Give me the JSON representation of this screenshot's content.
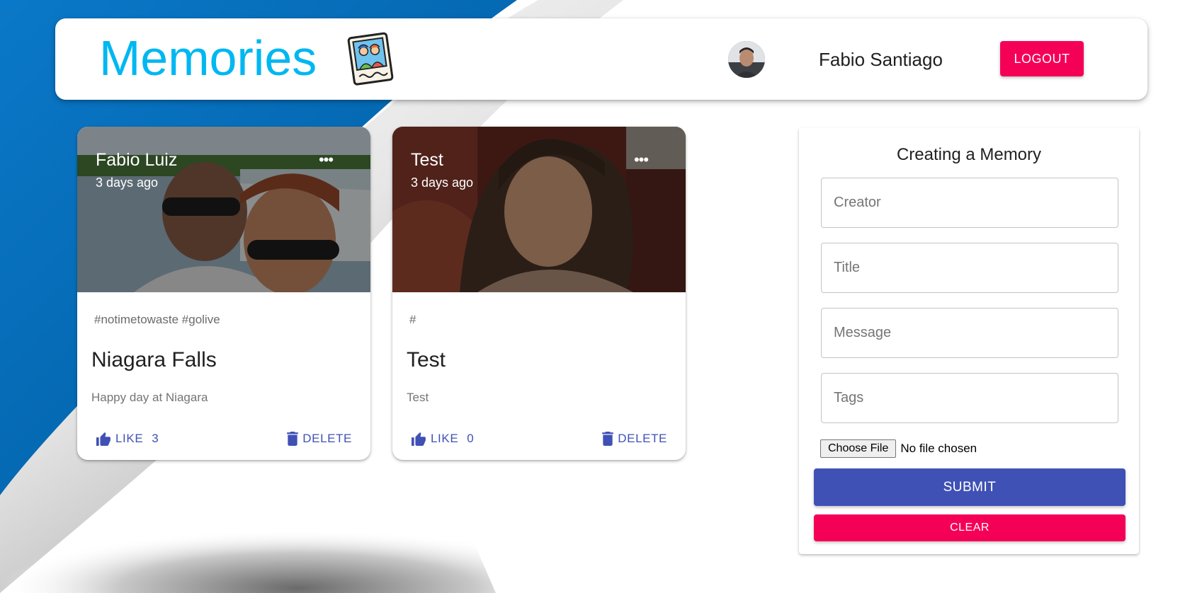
{
  "theme": {
    "brand_color": "#00b7f1",
    "primary": "#3f51b5",
    "secondary": "#f50057",
    "background_blue": "#0a6bbf"
  },
  "header": {
    "brand": "Memories",
    "brand_image_icon": "memories-photo-icon",
    "avatar_icon": "user-avatar",
    "user_name": "Fabio Santiago",
    "logout_label": "LOGOUT"
  },
  "posts": [
    {
      "author": "Fabio Luiz",
      "time": "3 days ago",
      "more_icon": "more-horizontal-icon",
      "tags": "#notimetowaste #golive",
      "title": "Niagara Falls",
      "message": "Happy day at Niagara",
      "like_label": "LIKE",
      "like_count": "3",
      "delete_label": "DELETE"
    },
    {
      "author": "Test",
      "time": "3 days ago",
      "more_icon": "more-horizontal-icon",
      "tags": "#",
      "title": "Test",
      "message": "Test",
      "like_label": "LIKE",
      "like_count": "0",
      "delete_label": "DELETE"
    }
  ],
  "form": {
    "heading": "Creating a Memory",
    "creator_placeholder": "Creator",
    "title_placeholder": "Title",
    "message_placeholder": "Message",
    "tags_placeholder": "Tags",
    "choose_file_label": "Choose File",
    "file_status": "No file chosen",
    "submit_label": "SUBMIT",
    "clear_label": "CLEAR"
  }
}
